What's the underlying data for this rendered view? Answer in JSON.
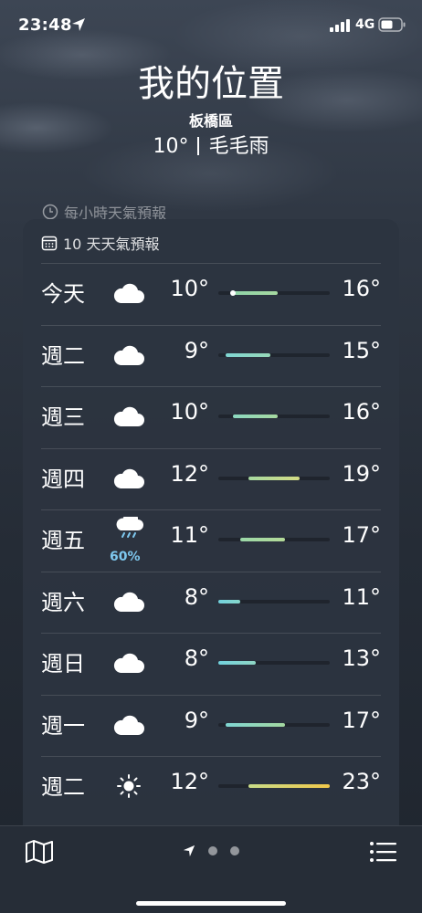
{
  "status": {
    "time": "23:48",
    "network": "4G"
  },
  "header": {
    "title": "我的位置",
    "district": "板橋區",
    "temp": "10°",
    "condition": "毛毛雨"
  },
  "hourly_label": "每小時天氣預報",
  "forecast_label": "10 天天氣預報",
  "days": [
    {
      "day": "今天",
      "icon": "cloud-icon",
      "precip": "",
      "low": "10°",
      "high": "16°",
      "bar_low": 10,
      "bar_high": 16,
      "color_from": "#8fd3a8",
      "color_to": "#a6d9a0",
      "current": 10
    },
    {
      "day": "週二",
      "icon": "cloud-icon",
      "precip": "",
      "low": "9°",
      "high": "15°",
      "bar_low": 9,
      "bar_high": 15,
      "color_from": "#7fd6d3",
      "color_to": "#97d8b8",
      "current": null
    },
    {
      "day": "週三",
      "icon": "cloud-icon",
      "precip": "",
      "low": "10°",
      "high": "16°",
      "bar_low": 10,
      "bar_high": 16,
      "color_from": "#8bd8c0",
      "color_to": "#a6d9a0",
      "current": null
    },
    {
      "day": "週四",
      "icon": "cloud-icon",
      "precip": "",
      "low": "12°",
      "high": "19°",
      "bar_low": 12,
      "bar_high": 19,
      "color_from": "#a6d9a0",
      "color_to": "#d4dc84",
      "current": null
    },
    {
      "day": "週五",
      "icon": "rain-cloud-icon",
      "precip": "60%",
      "low": "11°",
      "high": "17°",
      "bar_low": 11,
      "bar_high": 17,
      "color_from": "#9bd8a8",
      "color_to": "#b4da98",
      "current": null
    },
    {
      "day": "週六",
      "icon": "cloud-icon",
      "precip": "",
      "low": "8°",
      "high": "11°",
      "bar_low": 8,
      "bar_high": 11,
      "color_from": "#72d2de",
      "color_to": "#86d6ca",
      "current": null
    },
    {
      "day": "週日",
      "icon": "cloud-icon",
      "precip": "",
      "low": "8°",
      "high": "13°",
      "bar_low": 8,
      "bar_high": 13,
      "color_from": "#72d2de",
      "color_to": "#8fd6c4",
      "current": null
    },
    {
      "day": "週一",
      "icon": "cloud-icon",
      "precip": "",
      "low": "9°",
      "high": "17°",
      "bar_low": 9,
      "bar_high": 17,
      "color_from": "#7fd6d3",
      "color_to": "#a4d8a0",
      "current": null
    },
    {
      "day": "週二",
      "icon": "sun-icon",
      "precip": "",
      "low": "12°",
      "high": "23°",
      "bar_low": 12,
      "bar_high": 23,
      "color_from": "#c8dc88",
      "color_to": "#f1c84a",
      "current": null
    }
  ],
  "range": {
    "min": 8,
    "max": 23
  },
  "colors": {
    "card_bg": "#2c3440",
    "rain_accent": "#7ec8ef"
  }
}
